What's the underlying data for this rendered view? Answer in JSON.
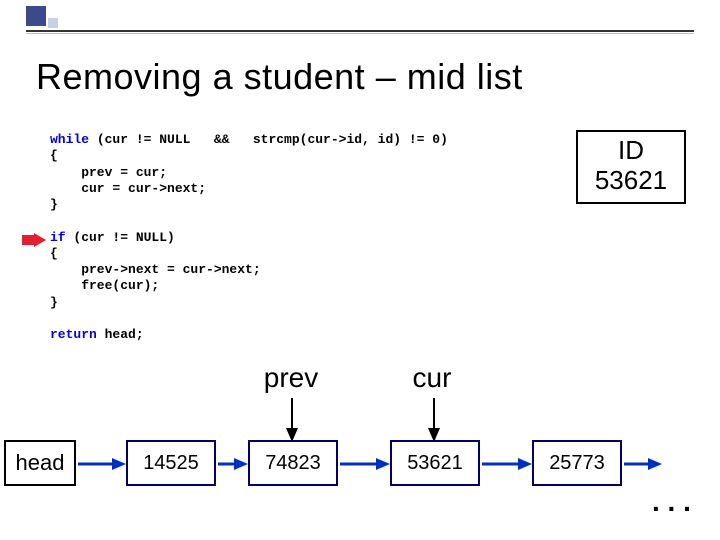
{
  "title": "Removing a student – mid list",
  "id_box": {
    "label": "ID",
    "value": "53621"
  },
  "code": {
    "l1a": "while",
    "l1b": " (cur != NULL   &&   strcmp(cur->id, id) != 0)",
    "l2": "{",
    "l3": "    prev = cur;",
    "l4": "    cur = cur->next;",
    "l5": "}",
    "l6": "",
    "l7a": "if",
    "l7b": " (cur != NULL)",
    "l8": "{",
    "l9": "    prev->next = cur->next;",
    "l10": "    free(cur);",
    "l11": "}",
    "l12": "",
    "l13a": "return",
    "l13b": " head;"
  },
  "pointers": {
    "prev": "prev",
    "cur": "cur"
  },
  "head_label": "head",
  "nodes": [
    "14525",
    "74823",
    "53621",
    "25773"
  ],
  "ellipsis": ". . ."
}
